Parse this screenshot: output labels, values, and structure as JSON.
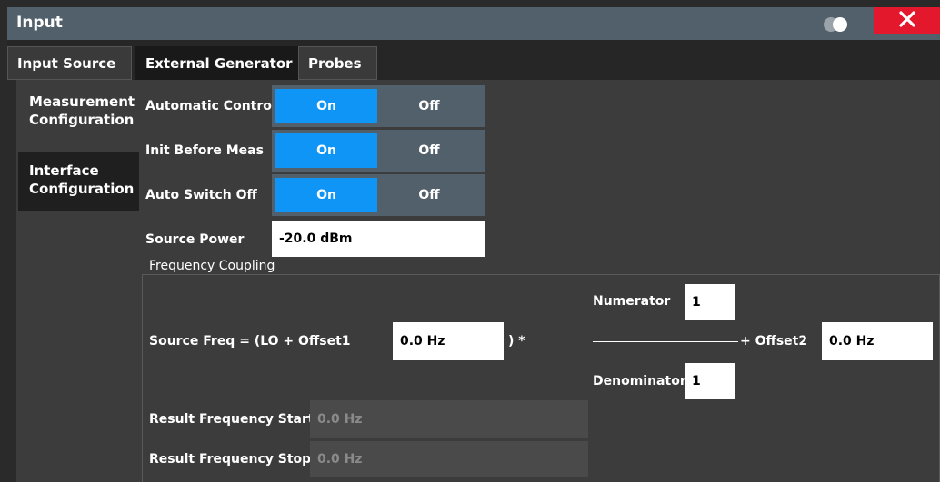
{
  "window": {
    "title": "Input",
    "close_icon": "close-icon",
    "toggle_icon": "display-toggle-icon"
  },
  "tabs": [
    {
      "label": "Input Source",
      "active": false
    },
    {
      "label": "External Generator",
      "active": true
    },
    {
      "label": "Probes",
      "active": false
    }
  ],
  "sidenav": [
    {
      "label": "Measurement Configuration",
      "active": true
    },
    {
      "label": "Interface Configuration",
      "active": false
    }
  ],
  "settings": {
    "automatic_control": {
      "label": "Automatic Control",
      "on": "On",
      "off": "Off",
      "value": "On"
    },
    "init_before_meas": {
      "label": "Init Before Meas",
      "on": "On",
      "off": "Off",
      "value": "On"
    },
    "auto_switch_off": {
      "label": "Auto Switch Off",
      "on": "On",
      "off": "Off",
      "value": "On"
    },
    "source_power": {
      "label": "Source Power",
      "value": "-20.0 dBm"
    }
  },
  "frequency_coupling": {
    "title": "Frequency Coupling",
    "source_freq_label": "Source Freq = (LO + Offset1",
    "offset1_value": "0.0 Hz",
    "close_paren": ") *",
    "numerator_label": "Numerator",
    "numerator_value": "1",
    "denominator_label": "Denominator",
    "denominator_value": "1",
    "offset2_label": "+ Offset2",
    "offset2_value": "0.0 Hz",
    "result_start_label": "Result Frequency Start",
    "result_start_value": "0.0 Hz",
    "result_stop_label": "Result Frequency Stop",
    "result_stop_value": "0.0 Hz"
  },
  "colors": {
    "accent": "#0f95f5",
    "close": "#e3182d",
    "titlebar": "#52606b"
  }
}
